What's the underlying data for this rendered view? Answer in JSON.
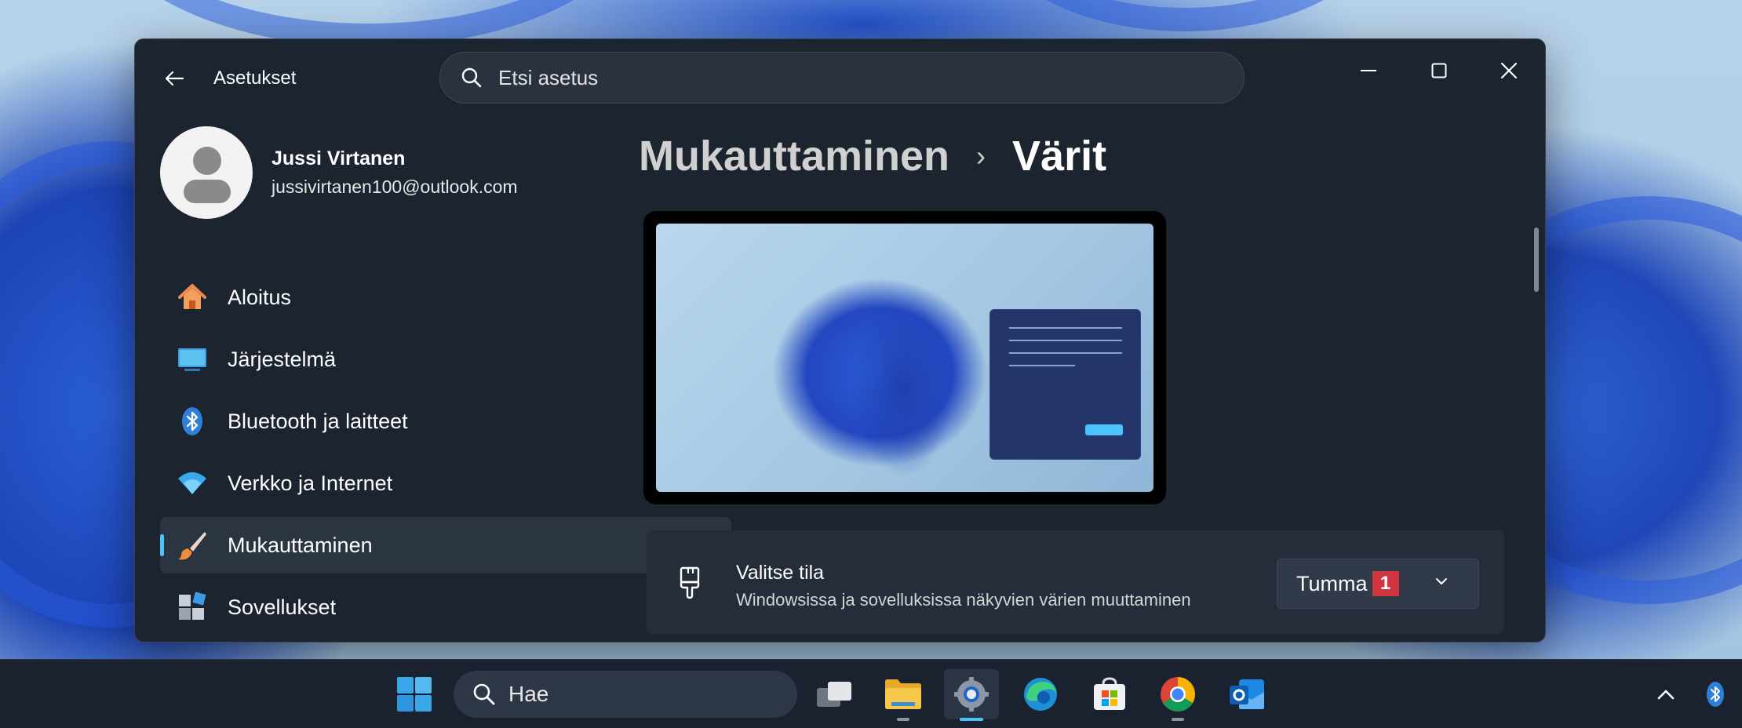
{
  "window": {
    "app_title": "Asetukset",
    "search_placeholder": "Etsi asetus"
  },
  "profile": {
    "name": "Jussi Virtanen",
    "email": "jussivirtanen100@outlook.com"
  },
  "nav": {
    "items": [
      {
        "label": "Aloitus",
        "icon": "home-icon"
      },
      {
        "label": "Järjestelmä",
        "icon": "monitor-icon"
      },
      {
        "label": "Bluetooth ja laitteet",
        "icon": "bluetooth-icon"
      },
      {
        "label": "Verkko ja Internet",
        "icon": "wifi-icon"
      },
      {
        "label": "Mukauttaminen",
        "icon": "paintbrush-icon",
        "active": true
      },
      {
        "label": "Sovellukset",
        "icon": "apps-icon"
      }
    ]
  },
  "breadcrumb": {
    "parent": "Mukauttaminen",
    "separator": "›",
    "current": "Värit"
  },
  "setting": {
    "title": "Valitse tila",
    "description": "Windowsissa ja sovelluksissa näkyvien värien muuttaminen",
    "value": "Tumma",
    "badge": "1"
  },
  "taskbar": {
    "search_label": "Hae",
    "apps": [
      "start-icon",
      "task-view-icon",
      "file-explorer-icon",
      "settings-icon",
      "edge-icon",
      "store-icon",
      "chrome-icon",
      "outlook-icon"
    ]
  },
  "colors": {
    "accent": "#4cc2ff",
    "window_bg": "#1c2430",
    "badge": "#d0343f"
  }
}
